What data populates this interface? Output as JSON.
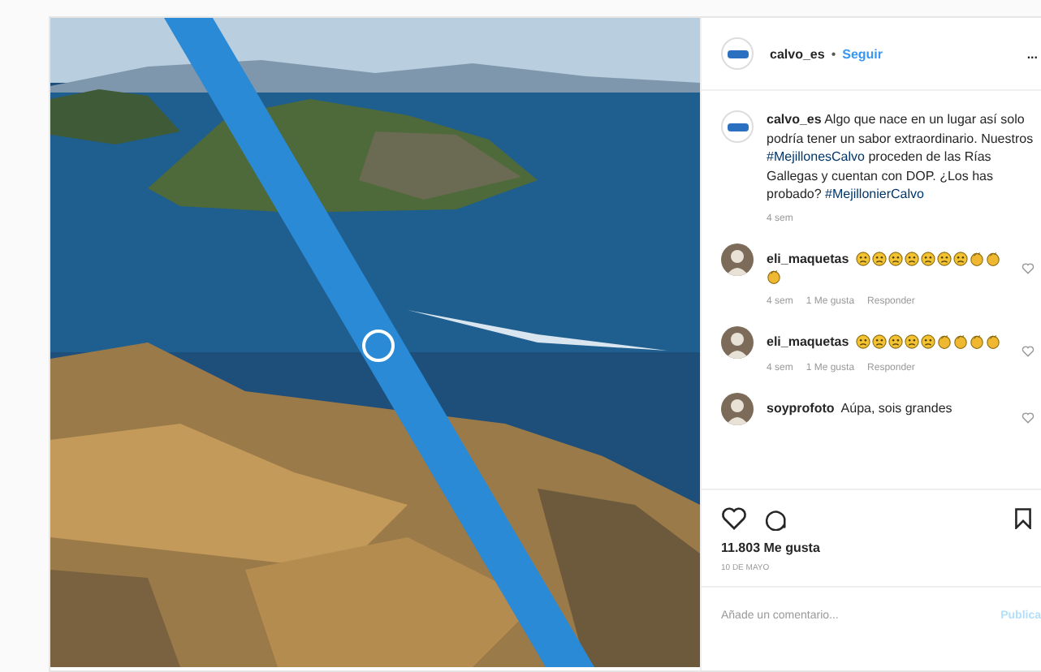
{
  "header": {
    "username": "calvo_es",
    "separator": "•",
    "follow": "Seguir",
    "more": "..."
  },
  "caption": {
    "username": "calvo_es",
    "parts": [
      {
        "kind": "text",
        "text": "Algo que nace en un lugar así solo podría tener un sabor extraordinario. Nuestros "
      },
      {
        "kind": "tag",
        "text": "#MejillonesCalvo"
      },
      {
        "kind": "text",
        "text": " proceden de las Rías Gallegas y cuentan con DOP. ¿Los has probado? "
      },
      {
        "kind": "tag",
        "text": "#MejillonierCalvo"
      }
    ],
    "time": "4 sem"
  },
  "comments": [
    {
      "username": "eli_maquetas",
      "emojis": [
        {
          "kind": "face"
        },
        {
          "kind": "face"
        },
        {
          "kind": "face"
        },
        {
          "kind": "face"
        },
        {
          "kind": "face"
        },
        {
          "kind": "face"
        },
        {
          "kind": "face"
        },
        {
          "kind": "clap"
        },
        {
          "kind": "clap"
        },
        {
          "kind": "clap"
        }
      ],
      "time": "4 sem",
      "likes": "1 Me gusta",
      "reply": "Responder"
    },
    {
      "username": "eli_maquetas",
      "emojis": [
        {
          "kind": "face"
        },
        {
          "kind": "face"
        },
        {
          "kind": "face"
        },
        {
          "kind": "face"
        },
        {
          "kind": "face"
        },
        {
          "kind": "clap"
        },
        {
          "kind": "clap"
        },
        {
          "kind": "clap"
        },
        {
          "kind": "clap"
        }
      ],
      "time": "4 sem",
      "likes": "1 Me gusta",
      "reply": "Responder"
    },
    {
      "username": "soyprofoto",
      "text": "Aúpa, sois grandes"
    }
  ],
  "likes": "11.803 Me gusta",
  "date": "10 DE MAYO",
  "add_comment": {
    "placeholder": "Añade un comentario...",
    "post": "Publica"
  }
}
